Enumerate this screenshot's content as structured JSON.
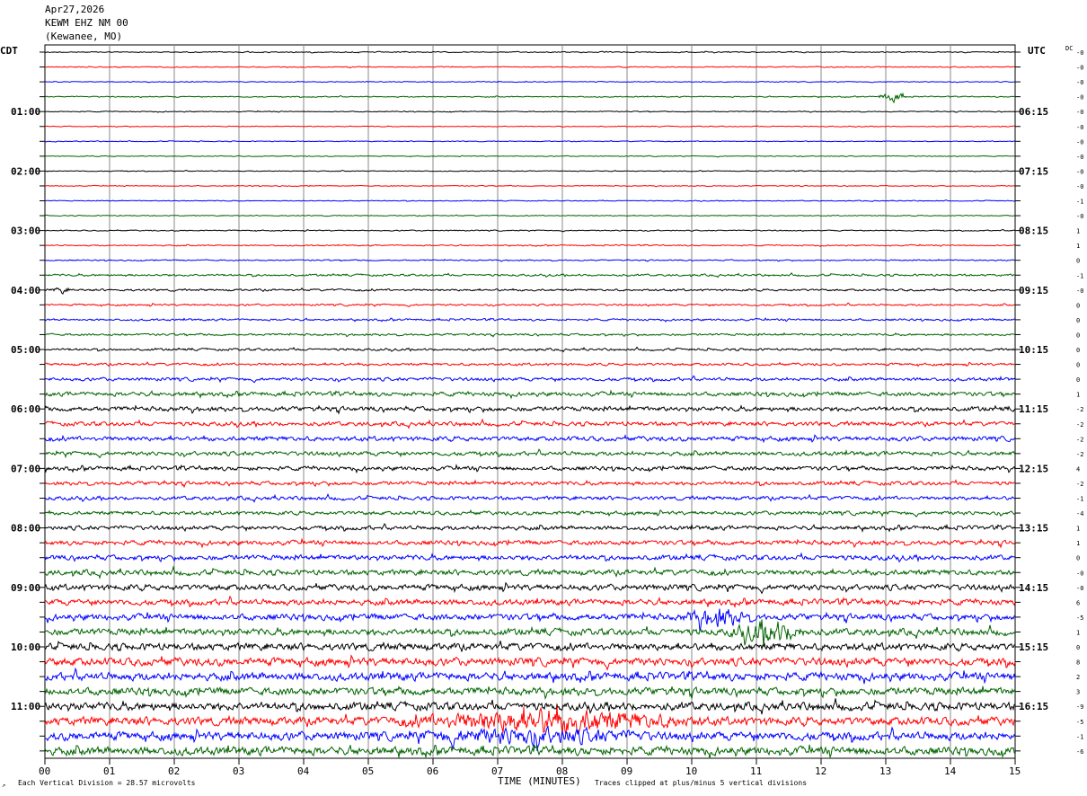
{
  "header": {
    "date": "Apr27,2026",
    "station": "KEWM EHZ NM 00",
    "location": "(Kewanee, MO)"
  },
  "left_tz": "CDT",
  "right_tz": "UTC",
  "dc_label": "DC",
  "footer": {
    "division_note": "Each Vertical Division =   28.57 microvolts",
    "clip_note": "Traces clipped at plus/minus 5 vertical divisions",
    "xlabel": "TIME (MINUTES)"
  },
  "chart_data": {
    "type": "line",
    "title": "KEWM EHZ NM 00 (Kewanee, MO) Apr27,2026",
    "xlabel": "TIME (MINUTES)",
    "xlim": [
      0,
      15
    ],
    "x_ticks": [
      "00",
      "01",
      "02",
      "03",
      "04",
      "05",
      "06",
      "07",
      "08",
      "09",
      "10",
      "11",
      "12",
      "13",
      "14",
      "15"
    ],
    "minutes_per_line": 15,
    "trace_count": 48,
    "trace_colors": [
      "#000000",
      "#ff0000",
      "#0000ff",
      "#006400"
    ],
    "left_time_labels": [
      {
        "row": 4,
        "label": "01:00"
      },
      {
        "row": 8,
        "label": "02:00"
      },
      {
        "row": 12,
        "label": "03:00"
      },
      {
        "row": 16,
        "label": "04:00"
      },
      {
        "row": 20,
        "label": "05:00"
      },
      {
        "row": 24,
        "label": "06:00"
      },
      {
        "row": 28,
        "label": "07:00"
      },
      {
        "row": 32,
        "label": "08:00"
      },
      {
        "row": 36,
        "label": "09:00"
      },
      {
        "row": 40,
        "label": "10:00"
      },
      {
        "row": 44,
        "label": "11:00"
      }
    ],
    "right_time_labels": [
      {
        "row": 4,
        "label": "06:15"
      },
      {
        "row": 8,
        "label": "07:15"
      },
      {
        "row": 12,
        "label": "08:15"
      },
      {
        "row": 16,
        "label": "09:15"
      },
      {
        "row": 20,
        "label": "10:15"
      },
      {
        "row": 24,
        "label": "11:15"
      },
      {
        "row": 28,
        "label": "12:15"
      },
      {
        "row": 32,
        "label": "13:15"
      },
      {
        "row": 36,
        "label": "14:15"
      },
      {
        "row": 40,
        "label": "15:15"
      },
      {
        "row": 44,
        "label": "16:15"
      }
    ],
    "dc_offsets": [
      "-0",
      "-0",
      "-0",
      "-0",
      "-0",
      "-0",
      "-0",
      "-0",
      "-0",
      "-0",
      "-1",
      "-0",
      "1",
      "1",
      "0",
      "-1",
      "-0",
      "0",
      "0",
      "0",
      "0",
      "0",
      "0",
      "1",
      "-2",
      "-2",
      "-2",
      "-2",
      "4",
      "-2",
      "-1",
      "-4",
      "1",
      "1",
      "0",
      "-0",
      "-0",
      "6",
      "-5",
      "1",
      "0",
      "8",
      "2",
      "3",
      "-9",
      "-5",
      "-1",
      "-6"
    ],
    "amplitude_divisions": [
      0.25,
      0.22,
      0.2,
      0.25,
      0.22,
      0.2,
      0.2,
      0.2,
      0.2,
      0.2,
      0.2,
      0.22,
      0.25,
      0.3,
      0.3,
      0.5,
      0.5,
      0.45,
      0.5,
      0.5,
      0.55,
      0.6,
      0.8,
      1.0,
      1.1,
      1.0,
      1.1,
      1.0,
      1.0,
      0.9,
      0.9,
      0.9,
      1.0,
      1.1,
      1.2,
      1.3,
      1.4,
      1.4,
      1.5,
      1.6,
      1.7,
      1.9,
      1.9,
      1.8,
      1.9,
      2.0,
      2.0,
      2.0
    ],
    "events": [
      {
        "trace": 3,
        "minute": 13.1,
        "width_min": 0.25,
        "amp_div": 2.5
      },
      {
        "trace": 16,
        "minute": 0.25,
        "width_min": 0.15,
        "amp_div": 1.5
      },
      {
        "trace": 38,
        "minute": 10.4,
        "width_min": 0.6,
        "amp_div": 4
      },
      {
        "trace": 39,
        "minute": 11.2,
        "width_min": 0.7,
        "amp_div": 5
      },
      {
        "trace": 45,
        "minute": 7.8,
        "width_min": 2.5,
        "amp_div": 5
      },
      {
        "trace": 46,
        "minute": 7.5,
        "width_min": 2.0,
        "amp_div": 3
      }
    ]
  }
}
